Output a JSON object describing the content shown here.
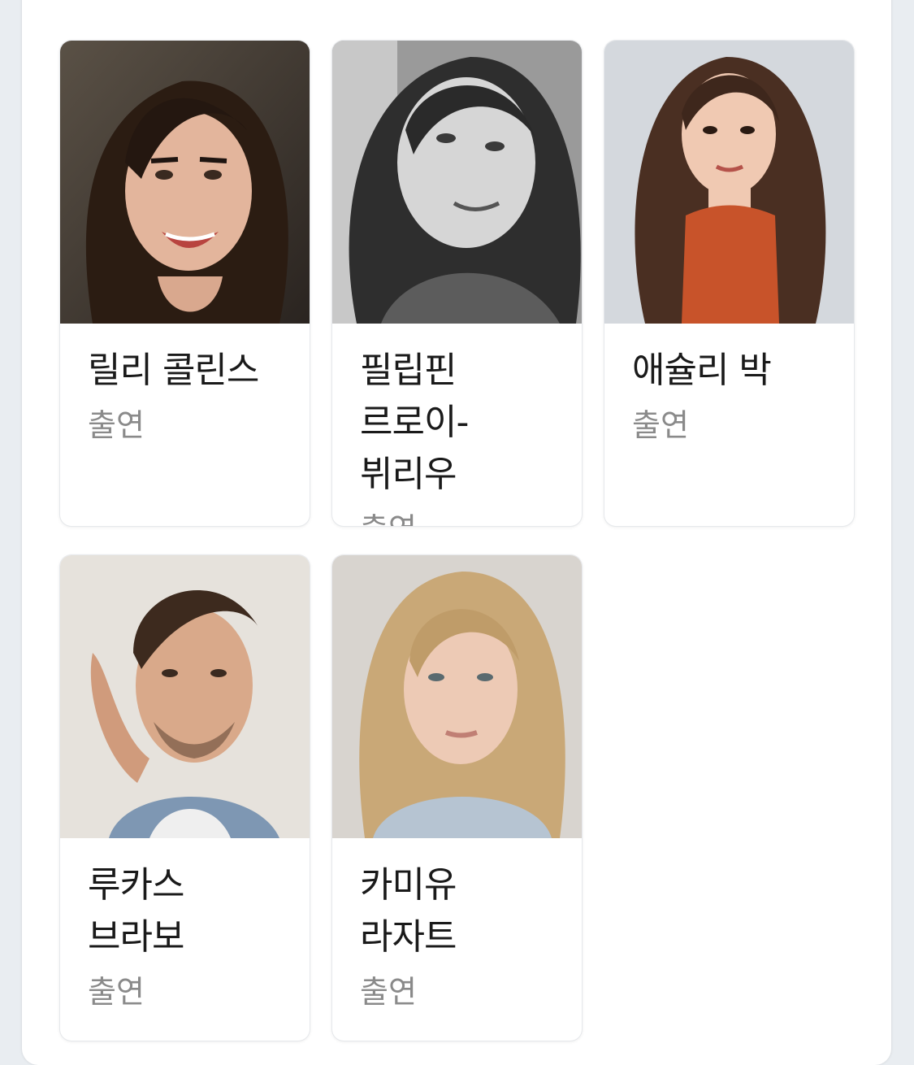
{
  "cast": [
    {
      "name": "릴리 콜린스",
      "role": "출연",
      "photo": "portrait-lily-collins"
    },
    {
      "name": "필립핀 르로이-뷔리우",
      "role": "출연",
      "photo": "portrait-philippine-leroy-beaulieu"
    },
    {
      "name": "애슐리 박",
      "role": "출연",
      "photo": "portrait-ashley-park"
    },
    {
      "name": "루카스 브라보",
      "role": "출연",
      "photo": "portrait-lucas-bravo"
    },
    {
      "name": "카미유 라자트",
      "role": "출연",
      "photo": "portrait-camille-razat"
    }
  ]
}
